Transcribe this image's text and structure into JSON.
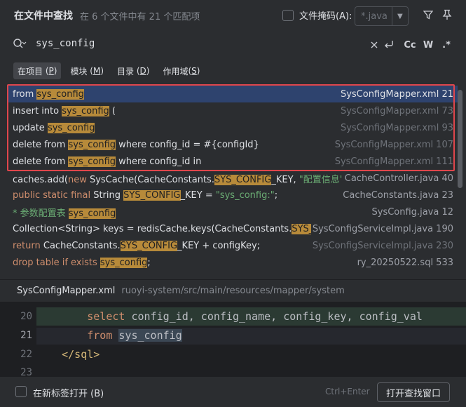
{
  "header": {
    "title": "在文件中查找",
    "subtitle": "在 6 个文件中有 21 个匹配项",
    "file_mask_label": "文件掩码(A):",
    "file_mask_value": "*.java",
    "icons": [
      "filter-icon",
      "pin-icon"
    ]
  },
  "search": {
    "query": "sys_config",
    "options": [
      "clear-icon",
      "regex-newline-icon",
      "Cc",
      "W",
      ".*"
    ]
  },
  "scopes": [
    {
      "label": "在项目",
      "key": "P",
      "active": true
    },
    {
      "label": "模块",
      "key": "M",
      "active": false
    },
    {
      "label": "目录",
      "key": "D",
      "active": false
    },
    {
      "label": "作用域",
      "key": "S",
      "active": false
    }
  ],
  "results": [
    {
      "pre": "from ",
      "match": "sys_config",
      "post": "",
      "file": "SysConfigMapper.xml 21"
    },
    {
      "pre": "insert into ",
      "match": "sys_config",
      "post": " (",
      "file": "SysConfigMapper.xml 73"
    },
    {
      "pre": "update ",
      "match": "sys_config",
      "post": "",
      "file": "SysConfigMapper.xml 93"
    },
    {
      "pre": "delete from ",
      "match": "sys_config",
      "post": " where config_id = #{configId}",
      "file": "SysConfigMapper.xml 107"
    },
    {
      "pre": "delete from ",
      "match": "sys_config",
      "post": " where config_id in",
      "file": "SysConfigMapper.xml 111"
    },
    {
      "pre": "caches.add(new SysCache(CacheConstants.",
      "match": "SYS_CONFIG",
      "post": "_KEY, \"配置信息\"));",
      "file": "CacheController.java 40"
    },
    {
      "pre": "public static final String ",
      "match": "SYS_CONFIG",
      "post": "_KEY = \"sys_config:\";",
      "file": "CacheConstants.java 23"
    },
    {
      "pre": "* 参数配置表 ",
      "match": "sys_config",
      "post": "",
      "file": "SysConfig.java 12"
    },
    {
      "pre": "Collection<String> keys = redisCache.keys(CacheConstants.",
      "match": "SYS_CON",
      "post": "",
      "file": "SysConfigServiceImpl.java 190"
    },
    {
      "pre": "return CacheConstants.",
      "match": "SYS_CONFIG",
      "post": "_KEY + configKey;",
      "file": "SysConfigServiceImpl.java 230"
    },
    {
      "pre": "drop table if exists ",
      "match": "sys_config",
      "post": ";",
      "file": "ry_20250522.sql 533"
    }
  ],
  "preview": {
    "file": "SysConfigMapper.xml",
    "path": "ruoyi-system/src/main/resources/mapper/system",
    "lines": [
      {
        "num": "20",
        "text": "        select config_id, config_name, config_key, config_val"
      },
      {
        "num": "21",
        "text": "        from sys_config"
      },
      {
        "num": "22",
        "text": "    </sql>"
      },
      {
        "num": "23",
        "text": ""
      }
    ]
  },
  "footer": {
    "new_tab_label": "在新标签打开 (B)",
    "hint": "Ctrl+Enter",
    "open_button": "打开查找窗口"
  },
  "colors": {
    "selection": "#2e436e",
    "match_highlight": "#b78a3a",
    "annotation_box": "#e0464c"
  }
}
